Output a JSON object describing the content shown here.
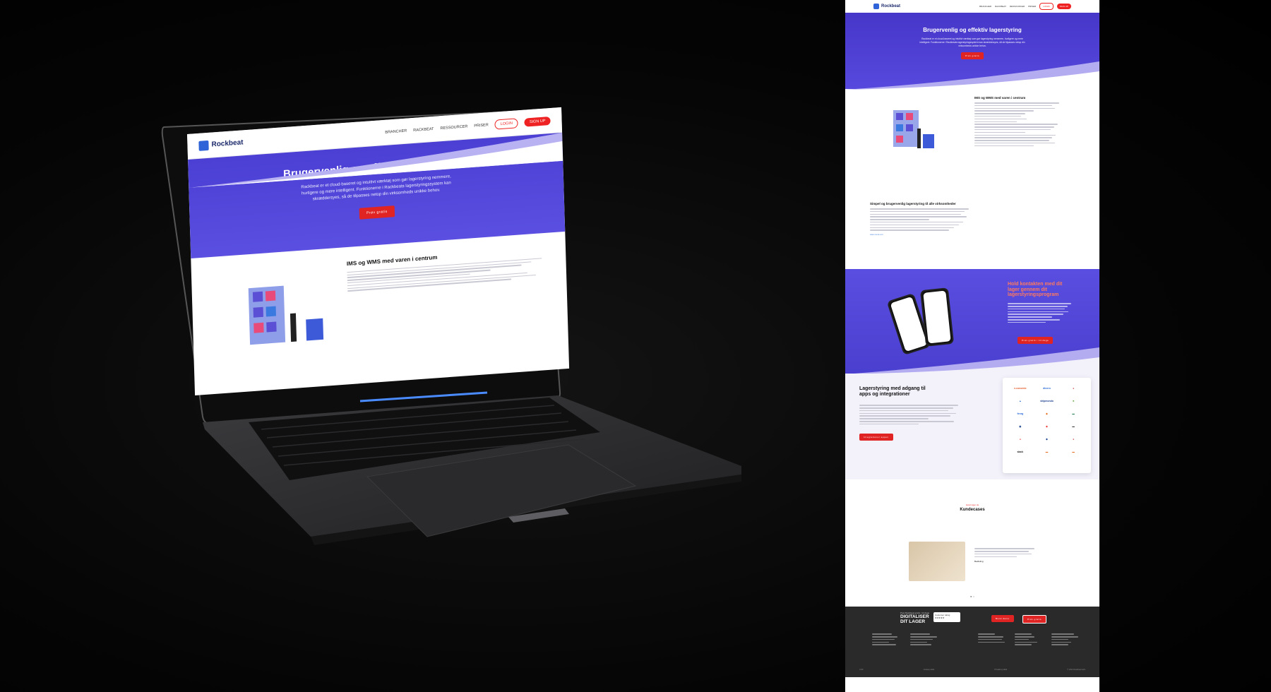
{
  "site": {
    "brand": "Rockbeat",
    "nav": {
      "items": [
        "Brancher",
        "Rackbeat",
        "Ressourcer",
        "Priser"
      ],
      "login": "Login",
      "signup": "Sign up"
    },
    "hero": {
      "title": "Brugervenlig og effektiv lagerstyring",
      "body": "Rackbeat er et cloud-baseret og intuitivt værktøj som gør lagerstyring nemmere, hurtigere og mere intelligent. Funktionerne i Rackbeats lagerstyringssystem kan skræddersyes, så de tilpasses netop din virksomheds unikke behov.",
      "cta": "Prøv gratis"
    },
    "section1": {
      "title": "IMS og WMS med varen i centrum",
      "title2": "Simpel og brugervenlig lagerstyring til alle virksomheder",
      "link": "Læs mere om"
    },
    "section2": {
      "title": "Hold kontakten med dit lager gennem dit lagerstyringsprogram",
      "cta": "Prøv gratis i 14 dage"
    },
    "section3": {
      "title": "Lagerstyring med adgang til apps og integrationer",
      "cta": "Integrationer appen",
      "logos": [
        "e-conomic",
        "dinero",
        "",
        "",
        "shipmondo",
        "",
        "fenrg",
        "",
        "",
        "shopify",
        "",
        "",
        "",
        "",
        "",
        "slack",
        "",
        ""
      ]
    },
    "cases": {
      "kicker": "Hvad siger de",
      "title": "Kundecases",
      "author": "Bedfeling",
      "dots": "● ○"
    },
    "footer": {
      "kicker": "Prøv Rackbeat gratis i 14 dage",
      "headline1": "DIGITALISER",
      "headline2": "DIT LAGER",
      "badge": "Customer rating ★★★★★",
      "b1": "Book demo",
      "b2": "Prøv gratis",
      "bottom": [
        "CVR",
        "Cookie politik",
        "Privatlivs politik",
        "© 2021 Rackbeat ApS"
      ]
    }
  },
  "colors": {
    "hero": "#4b3fd4",
    "accent": "#e02424",
    "brand": "#2f63d8"
  }
}
